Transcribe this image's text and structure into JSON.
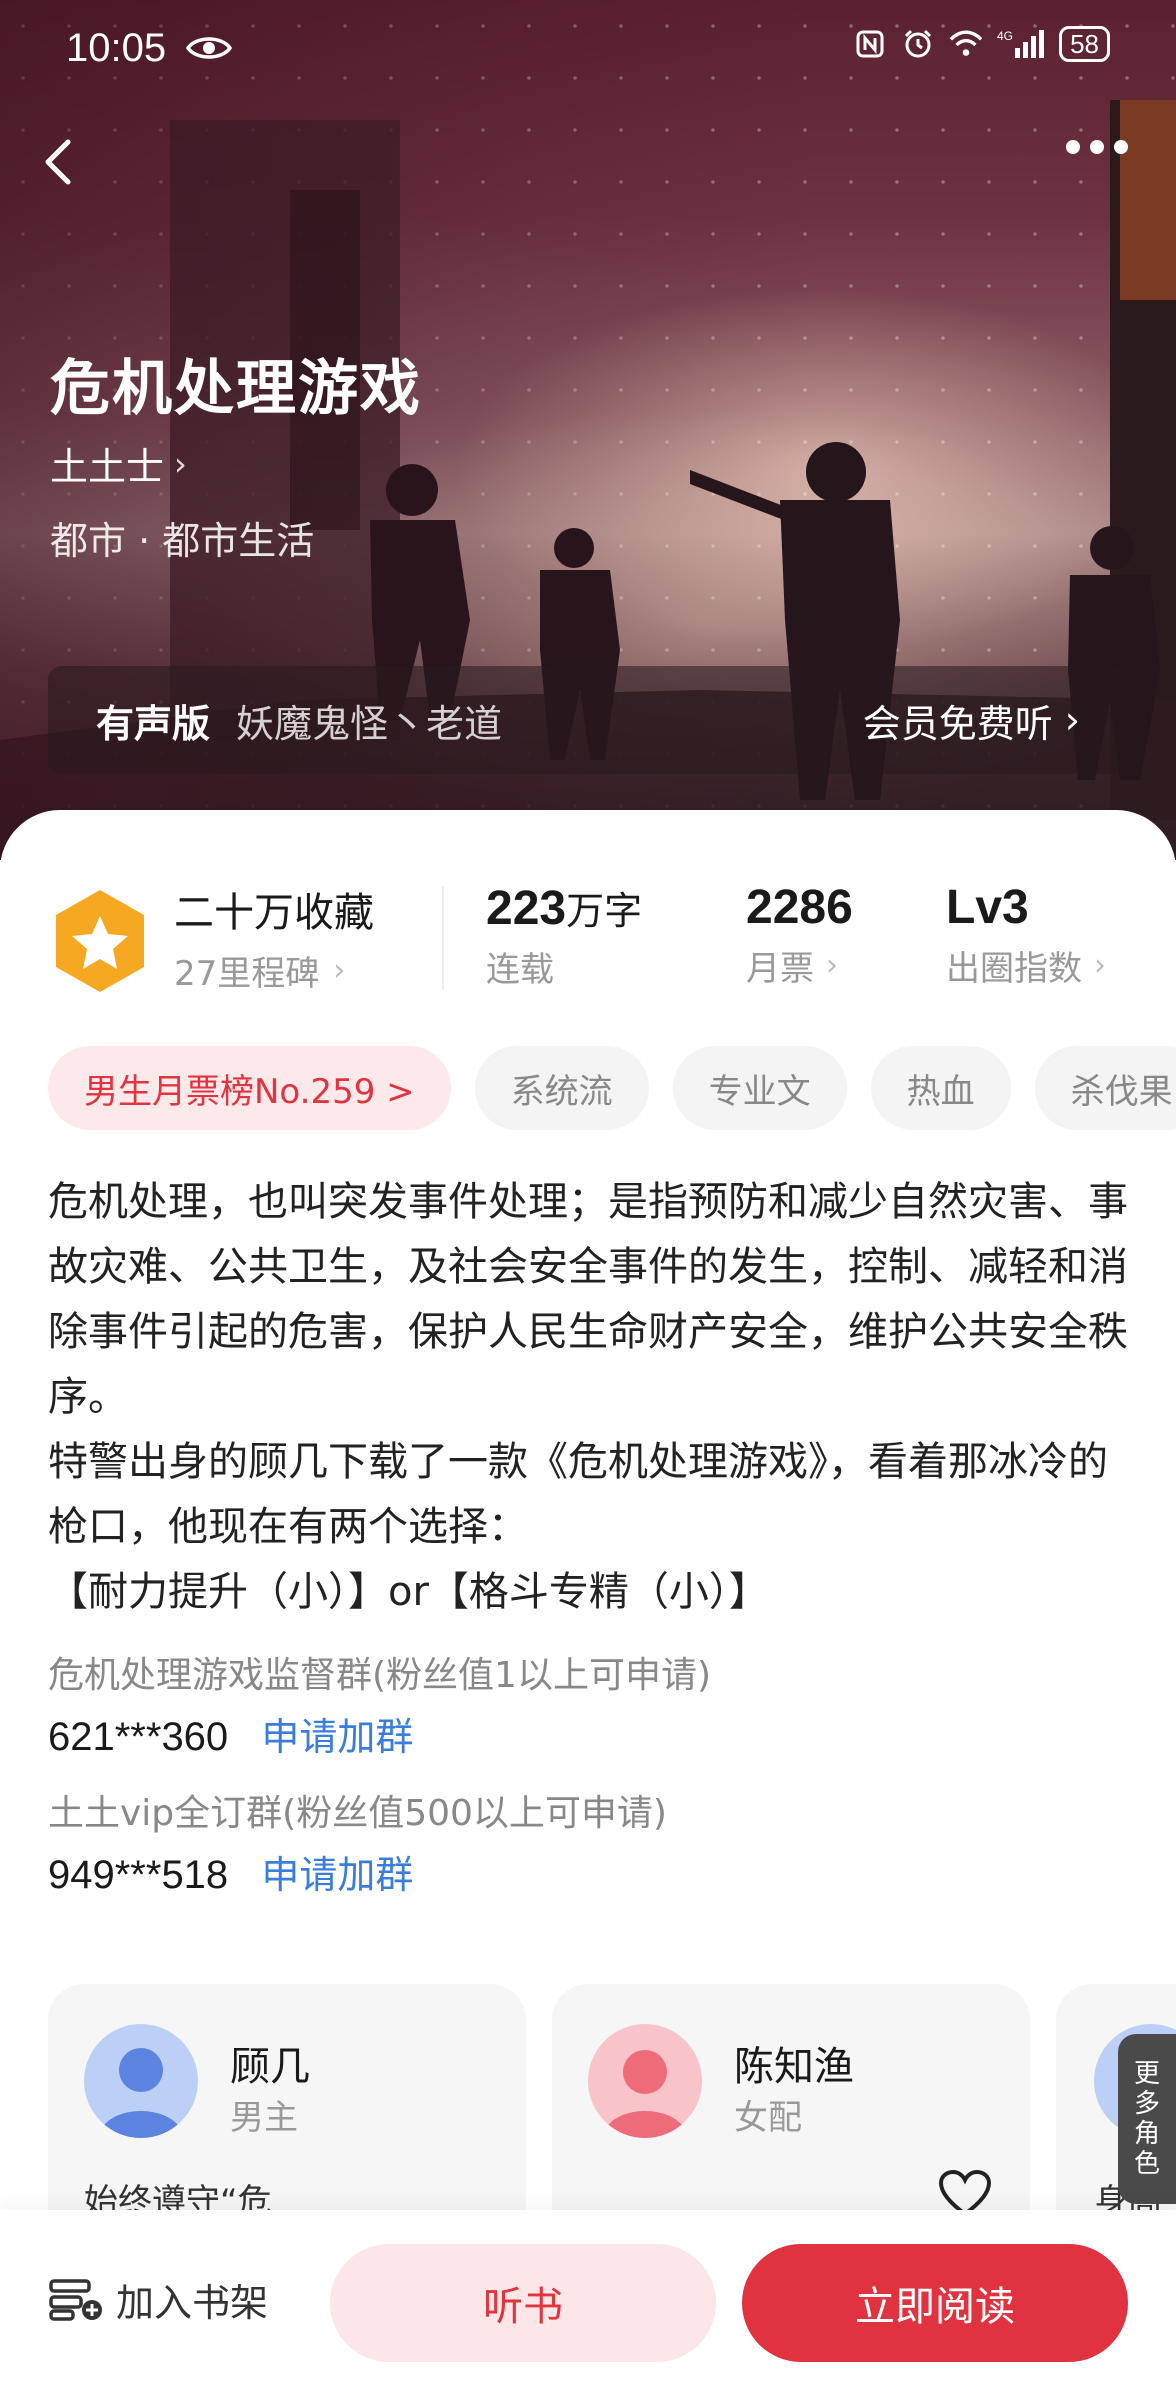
{
  "status_bar": {
    "time": "10:05",
    "network": "4G",
    "battery": "58"
  },
  "book": {
    "title": "危机处理游戏",
    "author": "土土士",
    "genre": "都市 · 都市生活"
  },
  "audio": {
    "label": "有声版",
    "narrators": "妖魔鬼怪丶老道",
    "free_listen": "会员免费听"
  },
  "stats": {
    "favorites": "二十万收藏",
    "milestones": "27里程碑",
    "word_count_num": "223",
    "word_count_unit": "万字",
    "word_count_label": "连载",
    "monthly_tickets": "2286",
    "monthly_tickets_label": "月票",
    "influence_level": "Lv3",
    "influence_label": "出圈指数"
  },
  "tags": [
    "男生月票榜No.259 >",
    "系统流",
    "专业文",
    "热血",
    "杀伐果"
  ],
  "description": [
    "危机处理，也叫突发事件处理；是指预防和减少自然灾害、事故灾难、公共卫生，及社会安全事件的发生，控制、减轻和消除事件引起的危害，保护人民生命财产安全，维护公共安全秩序。",
    "特警出身的顾几下载了一款《危机处理游戏》，看着那冰冷的枪口，他现在有两个选择：",
    "【耐力提升（小）】or【格斗专精（小）】"
  ],
  "groups": [
    {
      "title": "危机处理游戏监督群(粉丝值1以上可申请)",
      "number": "621***360",
      "join": "申请加群"
    },
    {
      "title": "土土vip全订群(粉丝值500以上可申请)",
      "number": "949***518",
      "join": "申请加群"
    }
  ],
  "characters": [
    {
      "name": "顾几",
      "role": "男主",
      "quote": "始终遵守“危"
    },
    {
      "name": "陈知渔",
      "role": "女配",
      "quote": ""
    },
    {
      "name": "",
      "role": "",
      "quote": "身高"
    }
  ],
  "more_roles": "更多角色",
  "bottom": {
    "shelf": "加入书架",
    "listen": "听书",
    "read": "立即阅读"
  },
  "colors": {
    "accent": "#e0323f",
    "accent_light": "#fde6e8",
    "link": "#3b7ddd",
    "medal": "#f7a823"
  }
}
